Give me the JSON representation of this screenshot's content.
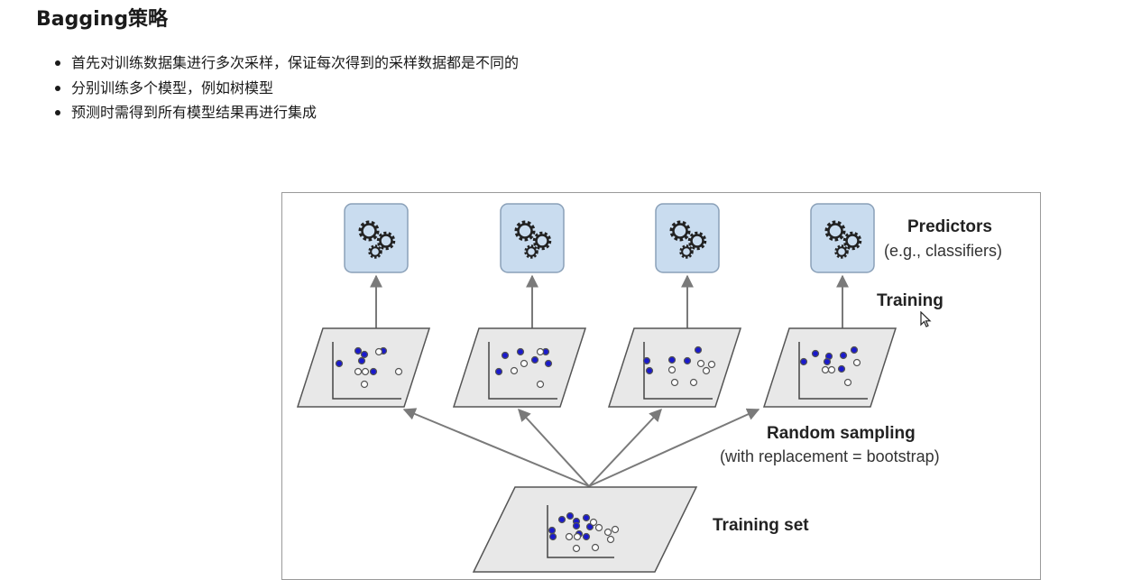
{
  "page": {
    "title": "Bagging策略",
    "bullets": [
      "首先对训练数据集进行多次采样，保证每次得到的采样数据都是不同的",
      "分别训练多个模型，例如树模型",
      "预测时需得到所有模型结果再进行集成"
    ]
  },
  "figure": {
    "labels": {
      "predictors": "Predictors",
      "predictors_sub": "(e.g., classifiers)",
      "training": "Training",
      "random_sampling": "Random sampling",
      "random_sampling_sub": "(with replacement = bootstrap)",
      "training_set": "Training set"
    },
    "predictor_icon": "gears-icon",
    "predictor_count": 4,
    "colors": {
      "predictor_fill": "#c9dcef",
      "panel_fill": "#e8e8e8",
      "arrow": "#7a7a7a",
      "dot_filled": "#1a1acc",
      "dot_hollow": "#ffffff"
    }
  }
}
